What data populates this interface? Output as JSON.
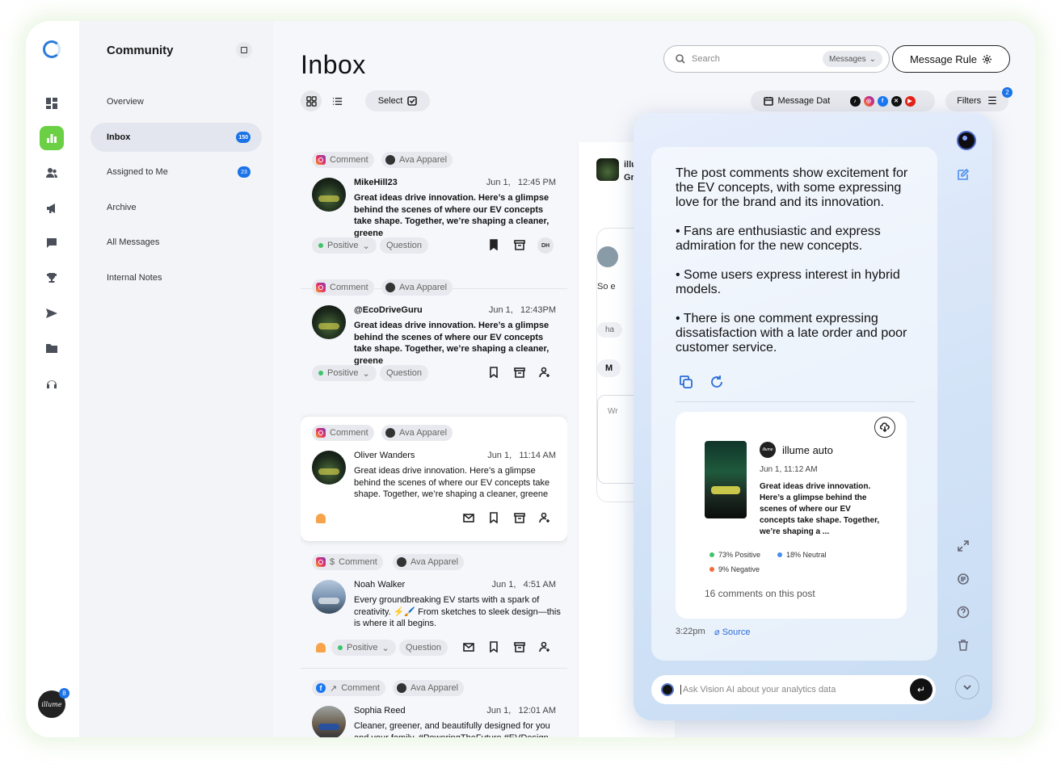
{
  "sidebar": {
    "title": "Community",
    "items": [
      {
        "label": "Overview"
      },
      {
        "label": "Inbox",
        "badge": "150"
      },
      {
        "label": "Assigned to Me",
        "badge": "23"
      },
      {
        "label": "Archive"
      },
      {
        "label": "All Messages"
      },
      {
        "label": "Internal Notes"
      }
    ],
    "avatar_label": "illume",
    "avatar_badge": "8"
  },
  "header": {
    "title": "Inbox",
    "select_label": "Select",
    "search_placeholder": "Search",
    "search_scope": "Messages",
    "message_rule_label": "Message Rule",
    "message_date_label": "Message Date",
    "filters_label": "Filters",
    "filters_badge": "2"
  },
  "messages": [
    {
      "type": "Comment",
      "source_icon": "instagram-icon",
      "brand": "Ava Apparel",
      "name": "MikeHill23",
      "date": "Jun 1,",
      "time": "12:45 PM",
      "body": "Great ideas drive innovation. Here’s a glimpse behind the scenes of where our EV concepts take shape. Together, we’re shaping a cleaner, greene",
      "sentiment": "Positive",
      "tag": "Question",
      "assignee": "DH"
    },
    {
      "type": "Comment",
      "source_icon": "instagram-icon",
      "brand": "Ava Apparel",
      "name": "@EcoDriveGuru",
      "date": "Jun 1,",
      "time": "12:43PM",
      "body": "Great ideas drive innovation. Here’s a glimpse behind the scenes of where our EV concepts take shape. Together, we’re shaping a cleaner, greene",
      "sentiment": "Positive",
      "tag": "Question"
    },
    {
      "type": "Comment",
      "source_icon": "instagram-icon",
      "brand": "Ava Apparel",
      "name": "Oliver Wanders",
      "date": "Jun 1,",
      "time": "11:14 AM",
      "body": "Great ideas drive innovation. Here’s a glimpse behind the scenes of where our EV concepts take shape. Together, we’re shaping a cleaner, greene"
    },
    {
      "type": "Comment",
      "source_icon": "instagram-icon",
      "brand": "Ava Apparel",
      "name": "Noah Walker",
      "date": "Jun 1,",
      "time": "4:51 AM",
      "body": "Every groundbreaking EV starts with a spark of creativity. ⚡🖌️ From sketches to sleek design—this is where it all begins.",
      "sentiment": "Positive",
      "tag": "Question"
    },
    {
      "type": "Comment",
      "source_icon": "facebook-icon",
      "brand": "Ava Apparel",
      "name": "Sophia Reed",
      "date": "Jun 1,",
      "time": "12:01 AM",
      "body": "Cleaner, greener, and beautifully designed for you and your family. #PoweringTheFuture #EVDesign"
    }
  ],
  "middle": {
    "header_name": "illu",
    "header_sub": "Gr",
    "preview_text": "So e",
    "chip_text": "ha",
    "button_text": "M",
    "input_text": "Wr"
  },
  "ai_panel": {
    "summary": [
      "The post comments show excitement for the EV concepts, with some expressing love for the brand and its innovation.",
      "• Fans are enthusiastic and express admiration for the new concepts.",
      "• Some users express interest in hybrid models.",
      "• There is one comment expressing dissatisfaction with a late order and poor customer service."
    ],
    "post": {
      "brand_logo": "illume",
      "account": "illume auto",
      "date": "Jun 1, 11:12 AM",
      "body": "Great ideas drive innovation. Here’s a glimpse behind the scenes of where our EV concepts take shape. Together, we’re shaping a ...",
      "positive": "73% Positive",
      "neutral": "18% Neutral",
      "negative": "9% Negative",
      "comments": "16 comments on this post"
    },
    "time": "3:22pm",
    "source_label": "Source",
    "input_placeholder": "Ask Vision AI about your analytics data"
  },
  "colors": {
    "accent": "#1a73e8",
    "active_green": "#6bd043",
    "positive": "#3ec46d",
    "neutral": "#4a8ef0",
    "negative": "#f26b3a"
  }
}
